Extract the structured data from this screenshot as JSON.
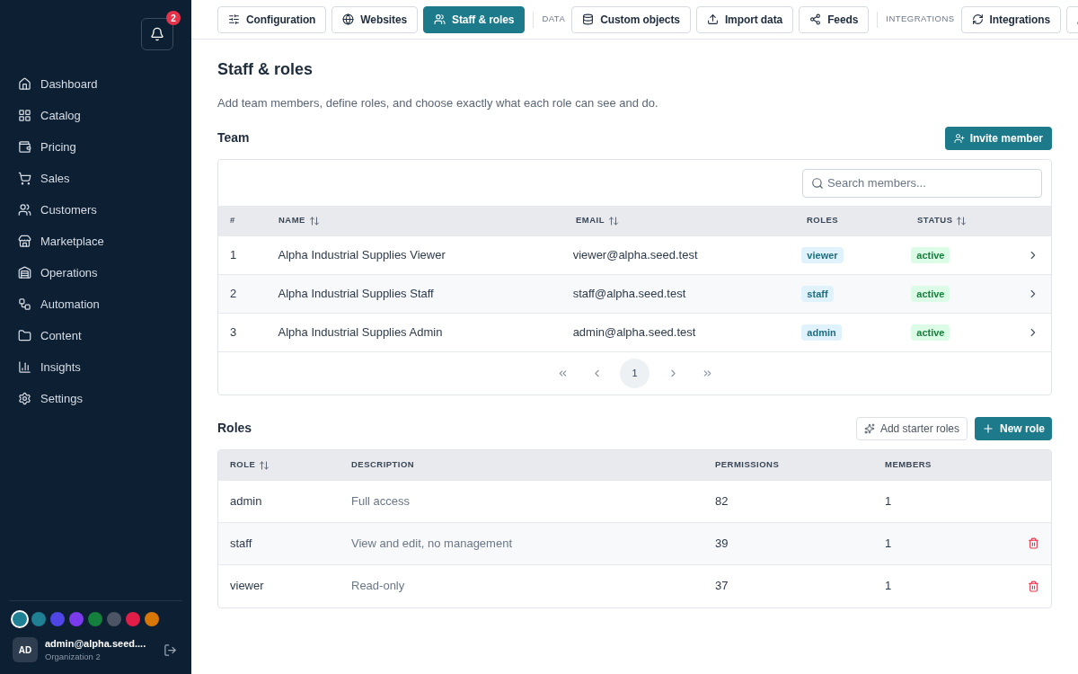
{
  "sidebar": {
    "notifications": {
      "count": "2"
    },
    "items": [
      {
        "label": "Dashboard"
      },
      {
        "label": "Catalog"
      },
      {
        "label": "Pricing"
      },
      {
        "label": "Sales"
      },
      {
        "label": "Customers"
      },
      {
        "label": "Marketplace"
      },
      {
        "label": "Operations"
      },
      {
        "label": "Automation"
      },
      {
        "label": "Content"
      },
      {
        "label": "Insights"
      },
      {
        "label": "Settings"
      }
    ],
    "themes": [
      {
        "color": "#1f7f93",
        "selected": true
      },
      {
        "color": "#1f7f93",
        "selected": false
      },
      {
        "color": "#4f46e5",
        "selected": false
      },
      {
        "color": "#7c3aed",
        "selected": false
      },
      {
        "color": "#15803d",
        "selected": false
      },
      {
        "color": "#4b5563",
        "selected": false
      },
      {
        "color": "#e11d48",
        "selected": false
      },
      {
        "color": "#d97706",
        "selected": false
      }
    ],
    "user": {
      "initials": "AD",
      "email": "admin@alpha.seed....",
      "org": "Organization 2"
    }
  },
  "toolbar": [
    {
      "kind": "tab",
      "label": "Configuration",
      "selected": false
    },
    {
      "kind": "tab",
      "label": "Websites",
      "selected": false
    },
    {
      "kind": "tab",
      "label": "Staff & roles",
      "selected": true
    },
    {
      "kind": "group",
      "label": "DATA"
    },
    {
      "kind": "tab",
      "label": "Custom objects",
      "selected": false
    },
    {
      "kind": "tab",
      "label": "Import data",
      "selected": false
    },
    {
      "kind": "tab",
      "label": "Feeds",
      "selected": false
    },
    {
      "kind": "group",
      "label": "INTEGRATIONS"
    },
    {
      "kind": "tab",
      "label": "Integrations",
      "selected": false
    },
    {
      "kind": "tab",
      "selected": false
    }
  ],
  "page": {
    "title": "Staff & roles",
    "subtitle": "Add team members, define roles, and choose exactly what each role can see and do."
  },
  "team": {
    "title": "Team",
    "action": "Invite member",
    "search": {
      "placeholder": "Search members..."
    },
    "columns": [
      {
        "label": "#",
        "sortable": false
      },
      {
        "label": "NAME",
        "sortable": true
      },
      {
        "label": "EMAIL",
        "sortable": true
      },
      {
        "label": "ROLES",
        "sortable": false
      },
      {
        "label": "STATUS",
        "sortable": true
      }
    ],
    "rows": [
      {
        "index": "1",
        "name": "Alpha Industrial Supplies Viewer",
        "email": "viewer@alpha.seed.test",
        "role": "viewer",
        "status": "active"
      },
      {
        "index": "2",
        "name": "Alpha Industrial Supplies Staff",
        "email": "staff@alpha.seed.test",
        "role": "staff",
        "status": "active"
      },
      {
        "index": "3",
        "name": "Alpha Industrial Supplies Admin",
        "email": "admin@alpha.seed.test",
        "role": "admin",
        "status": "active"
      }
    ],
    "pagination": {
      "pages": [
        {
          "label": "1",
          "selected": true
        }
      ]
    }
  },
  "roles": {
    "title": "Roles",
    "actions": [
      {
        "kind": "secondary",
        "label": "Add starter roles"
      },
      {
        "kind": "primary",
        "label": "New role"
      }
    ],
    "columns": [
      {
        "label": "ROLE",
        "sortable": true
      },
      {
        "label": "DESCRIPTION",
        "sortable": false
      },
      {
        "label": "PERMISSIONS",
        "sortable": false
      },
      {
        "label": "MEMBERS",
        "sortable": false
      }
    ],
    "rows": [
      {
        "role": "admin",
        "description": "Full access",
        "permissions": "82",
        "members": "1",
        "deletable": false
      },
      {
        "role": "staff",
        "description": "View and edit, no management",
        "permissions": "39",
        "members": "1",
        "deletable": true
      },
      {
        "role": "viewer",
        "description": "Read-only",
        "permissions": "37",
        "members": "1",
        "deletable": true
      }
    ]
  }
}
